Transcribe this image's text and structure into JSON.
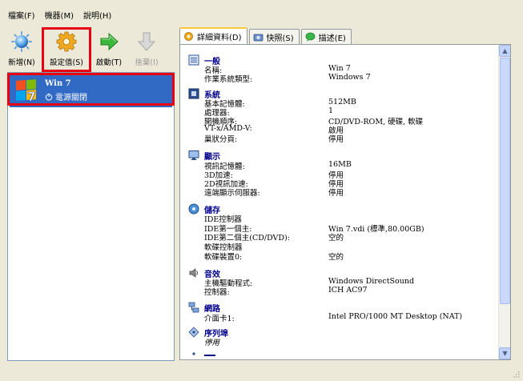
{
  "menu": {
    "items": [
      "檔案(F)",
      "機器(M)",
      "說明(H)"
    ]
  },
  "toolbar": {
    "new_label": "新增(N)",
    "settings_label": "設定值(S)",
    "start_label": "啟動(T)",
    "discard_label": "捨棄(I)"
  },
  "vm": {
    "name": "Win 7",
    "state": "電源關閉"
  },
  "tabs": {
    "details": "詳細資料(D)",
    "snapshots": "快照(S)",
    "description": "描述(E)"
  },
  "details": {
    "general": {
      "title": "一般",
      "rows": [
        {
          "k": "名稱:",
          "v": "Win 7"
        },
        {
          "k": "作業系統類型:",
          "v": "Windows 7"
        }
      ]
    },
    "system": {
      "title": "系統",
      "rows": [
        {
          "k": "基本記憶體:",
          "v": "512MB"
        },
        {
          "k": "處理器:",
          "v": "1"
        },
        {
          "k": "開機順序:",
          "v": "CD/DVD-ROM, 硬碟, 軟碟"
        },
        {
          "k": "VT-x/AMD-V:",
          "v": "啟用"
        },
        {
          "k": "巢狀分頁:",
          "v": "停用"
        }
      ]
    },
    "display": {
      "title": "顯示",
      "rows": [
        {
          "k": "視訊記憶體:",
          "v": "16MB"
        },
        {
          "k": "3D加速:",
          "v": "停用"
        },
        {
          "k": "2D視訊加速:",
          "v": "停用"
        },
        {
          "k": "遠端顯示伺服器:",
          "v": "停用"
        }
      ]
    },
    "storage": {
      "title": "儲存",
      "rows": [
        {
          "k": "IDE控制器",
          "v": ""
        },
        {
          "k": "IDE第一個主:",
          "v": "Win 7.vdi (標準,80.00GB)"
        },
        {
          "k": "IDE第二個主(CD/DVD):",
          "v": "空的"
        },
        {
          "k": "軟碟控制器",
          "v": ""
        },
        {
          "k": "軟碟裝置0:",
          "v": "空的"
        }
      ]
    },
    "audio": {
      "title": "音效",
      "rows": [
        {
          "k": "主機驅動程式:",
          "v": "Windows DirectSound"
        },
        {
          "k": "控制器:",
          "v": "ICH AC97"
        }
      ]
    },
    "network": {
      "title": "網路",
      "rows": [
        {
          "k": "介面卡1:",
          "v": "Intel PRO/1000 MT Desktop (NAT)"
        }
      ]
    },
    "serial": {
      "title": "序列埠",
      "status": "停用"
    }
  },
  "colors": {
    "selection": "#316ac5",
    "highlight_box": "#e60012",
    "section_title": "#00008b"
  }
}
